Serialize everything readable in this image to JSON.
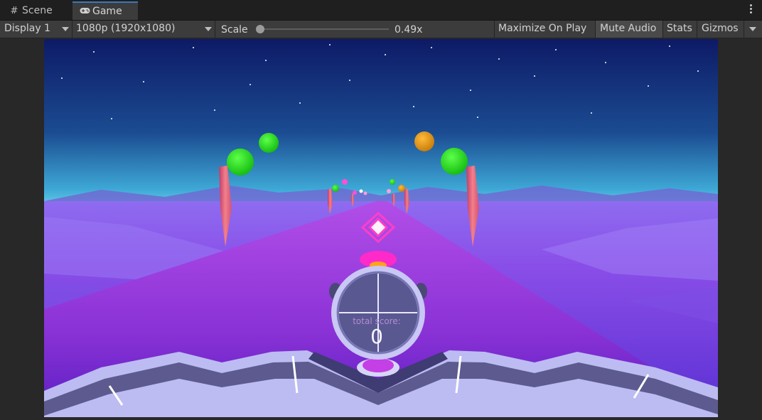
{
  "tabs": [
    {
      "label": "Scene",
      "icon": "grid-icon"
    },
    {
      "label": "Game",
      "icon": "gamepad-icon"
    }
  ],
  "toolbar": {
    "display": "Display 1",
    "resolution": "1080p (1920x1080)",
    "scale_label": "Scale",
    "scale_value": "0.49x",
    "scale_fraction": 0.0,
    "maximize": "Maximize On Play",
    "mute": "Mute Audio",
    "stats": "Stats",
    "gizmos": "Gizmos"
  },
  "game": {
    "score_label": "total score:",
    "score_value": "0"
  },
  "colors": {
    "sky_top": "#0e1a66",
    "sky_horizon": "#3fb0d8",
    "ground": "#8a3fe6",
    "road": "#a23ee0",
    "orb_green": "#22d61e",
    "orb_orange": "#e79a12",
    "accent_magenta": "#ff1fd0"
  }
}
